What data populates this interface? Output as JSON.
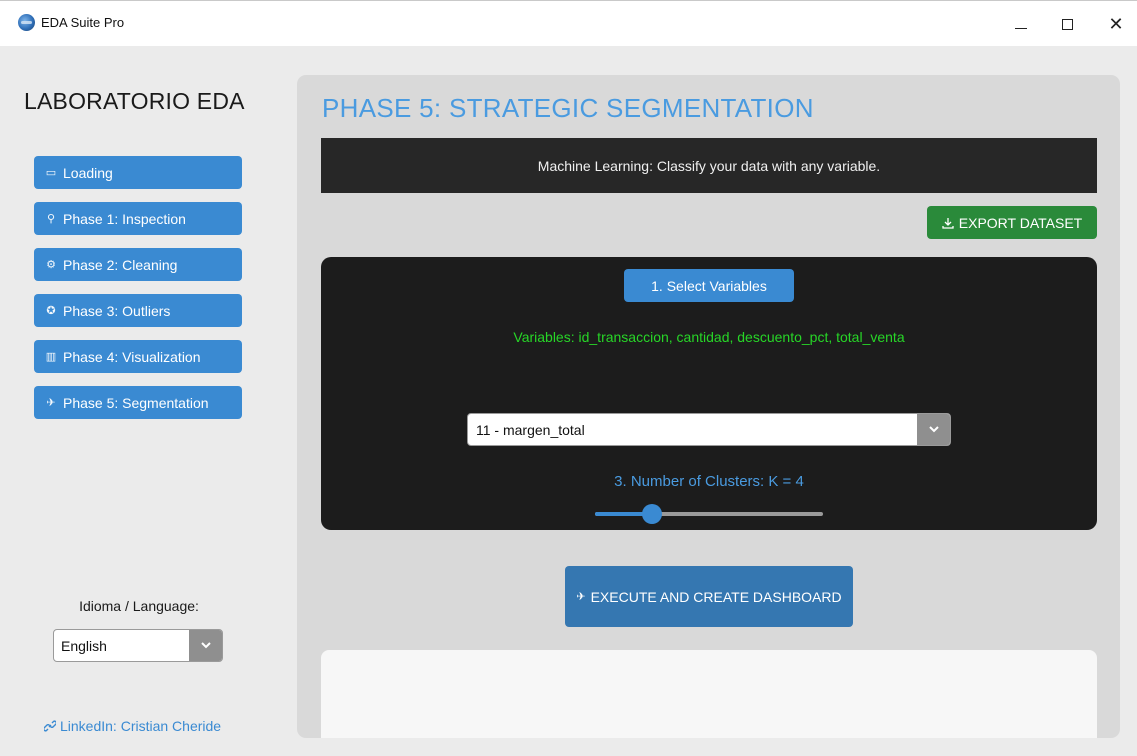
{
  "window": {
    "title": "EDA Suite Pro",
    "minimize_glyph": "–",
    "close_glyph": "✕"
  },
  "sidebar": {
    "brand": "LABORATORIO EDA",
    "items": [
      {
        "label": "Loading",
        "icon": "folder-icon",
        "glyph": "▭"
      },
      {
        "label": "Phase 1: Inspection",
        "icon": "search-icon",
        "glyph": "⚲"
      },
      {
        "label": "Phase 2: Cleaning",
        "icon": "gear-icon",
        "glyph": "⚙"
      },
      {
        "label": "Phase 3: Outliers",
        "icon": "outliers-icon",
        "glyph": "✪"
      },
      {
        "label": "Phase 4: Visualization",
        "icon": "bar-chart-icon",
        "glyph": "▥"
      },
      {
        "label": "Phase 5: Segmentation",
        "icon": "rocket-icon",
        "glyph": "✈"
      }
    ],
    "language_label": "Idioma / Language:",
    "language_value": "English",
    "linkedin_label": "LinkedIn: Cristian Cheride"
  },
  "main": {
    "title": "PHASE 5: STRATEGIC SEGMENTATION",
    "banner": "Machine Learning: Classify your data with any variable.",
    "export_label": "EXPORT DATASET",
    "select_vars_label": "1. Select Variables",
    "variables_text": "Variables: id_transaccion, cantidad, descuento_pct, total_venta",
    "target_label": "",
    "target_value": "11 - margen_total",
    "k_label": "3. Number of Clusters: K = 4",
    "k_value": 4,
    "k_slider_fraction": 0.25,
    "execute_label": "EXECUTE AND CREATE DASHBOARD"
  },
  "colors": {
    "accent": "#3a8ad2",
    "title_blue": "#4a9be0",
    "export_green": "#2a8a3a",
    "variables_green": "#27d627",
    "execute_blue": "#3577b1"
  }
}
